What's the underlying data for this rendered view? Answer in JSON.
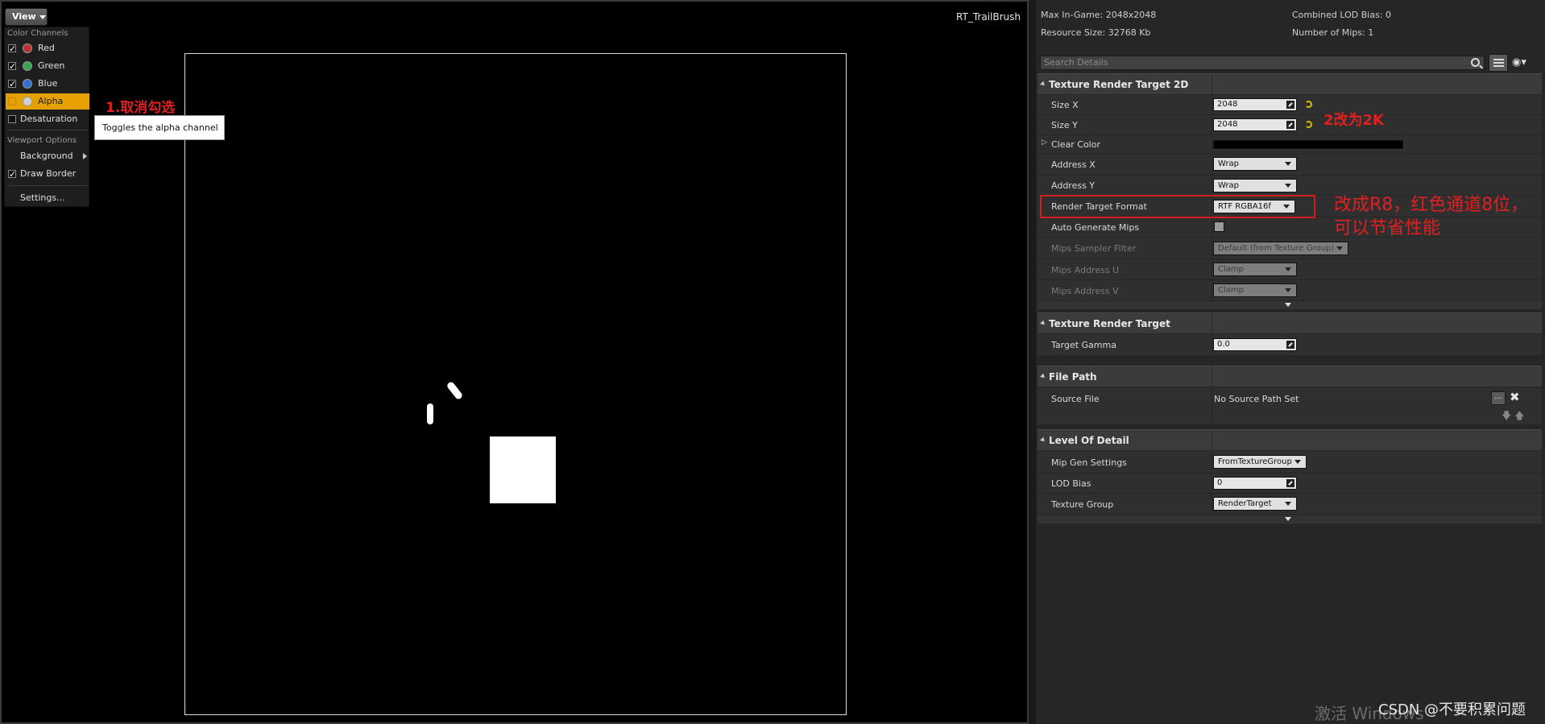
{
  "viewport": {
    "texture_name": "RT_TrailBrush",
    "view_button": "View",
    "menu": {
      "color_channels_header": "Color Channels",
      "channels": [
        {
          "label": "Red",
          "checked": true,
          "color": "#c03030"
        },
        {
          "label": "Green",
          "checked": true,
          "color": "#2fa84f"
        },
        {
          "label": "Blue",
          "checked": true,
          "color": "#2e6fd0"
        },
        {
          "label": "Alpha",
          "checked": false,
          "color": "#d0d0d0"
        },
        {
          "label": "Desaturation",
          "checked": false
        }
      ],
      "viewport_options_header": "Viewport Options",
      "background": "Background",
      "draw_border": "Draw Border",
      "settings": "Settings..."
    },
    "tooltip": "Toggles the alpha channel",
    "annotation_1": "1.取消勾选"
  },
  "details": {
    "info": {
      "max_ingame": "Max In-Game: 2048x2048",
      "resource_size": "Resource Size: 32768 Kb",
      "combined_lod_bias": "Combined LOD Bias: 0",
      "number_of_mips": "Number of Mips: 1"
    },
    "search_placeholder": "Search Details",
    "sections": {
      "trt2d": {
        "title": "Texture Render Target 2D",
        "size_x_label": "Size X",
        "size_x": "2048",
        "size_y_label": "Size Y",
        "size_y": "2048",
        "clear_color_label": "Clear Color",
        "address_x_label": "Address X",
        "address_x": "Wrap",
        "address_y_label": "Address Y",
        "address_y": "Wrap",
        "rt_format_label": "Render Target Format",
        "rt_format": "RTF RGBA16f",
        "auto_mips_label": "Auto Generate Mips",
        "mips_filter_label": "Mips Sampler Filter",
        "mips_filter": "Default (from Texture Group)",
        "mips_u_label": "Mips Address U",
        "mips_u": "Clamp",
        "mips_v_label": "Mips Address V",
        "mips_v": "Clamp"
      },
      "trt": {
        "title": "Texture Render Target",
        "gamma_label": "Target Gamma",
        "gamma": "0.0"
      },
      "file_path": {
        "title": "File Path",
        "source_file_label": "Source File",
        "source_file": "No Source Path Set",
        "browse": "..."
      },
      "lod": {
        "title": "Level Of Detail",
        "mip_gen_label": "Mip Gen Settings",
        "mip_gen": "FromTextureGroup",
        "lod_bias_label": "LOD Bias",
        "lod_bias": "0",
        "tex_group_label": "Texture Group",
        "tex_group": "RenderTarget"
      }
    },
    "annotation_2": "2改为2K",
    "annotation_3": "改成R8，红色通道8位，可以节省性能"
  },
  "watermark": {
    "windows": "激活 Windows",
    "csdn": "CSDN @不要积累问题"
  }
}
